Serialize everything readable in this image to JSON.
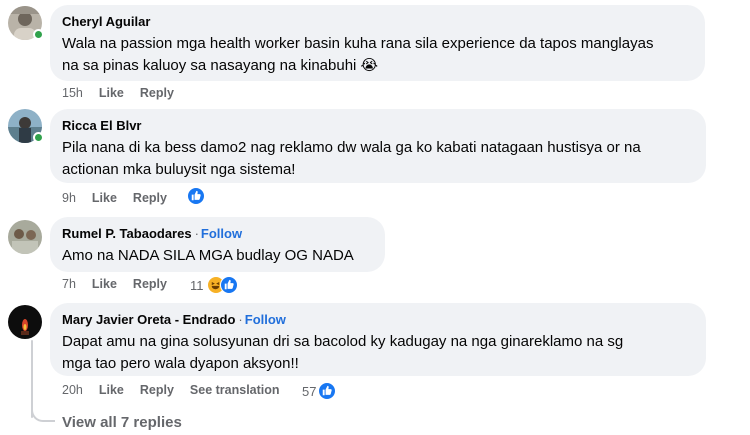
{
  "comments": [
    {
      "author": "Cheryl Aguilar",
      "follow": "",
      "text_line1": "Wala na passion mga health worker basin kuha rana sila experience da tapos manglayas",
      "text_line2": "na sa pinas kaluoy sa nasayang na kinabuhi",
      "emoji": "😭",
      "time": "15h",
      "like": "Like",
      "reply": "Reply",
      "online": true
    },
    {
      "author": "Ricca El Blvr",
      "follow": "",
      "text_line1": "Pila nana di ka bess damo2 nag reklamo dw wala ga ko kabati natagaan hustisya or na",
      "text_line2": "actionan mka buluysit nga sistema!",
      "time": "9h",
      "like": "Like",
      "reply": "Reply",
      "reaction_count": ""
    },
    {
      "author": "Rumel P. Tabaodares",
      "follow": "Follow",
      "text_line1": "Amo na NADA SILA MGA budlay OG NADA",
      "time": "7h",
      "like": "Like",
      "reply": "Reply",
      "reaction_count": "11"
    },
    {
      "author": "Mary Javier Oreta - Endrado",
      "follow": "Follow",
      "text_line1": "Dapat amu na gina solusyunan dri sa bacolod ky kadugay na nga ginareklamo na sg",
      "text_line2": "mga tao pero wala dyapon aksyon!!",
      "time": "20h",
      "like": "Like",
      "reply": "Reply",
      "see_translation": "See translation",
      "reaction_count": "57"
    }
  ],
  "view_replies": "View all 7 replies",
  "colors": {
    "bubble": "#f0f2f5",
    "secondary_text": "#65676b",
    "follow_link": "#216fdb",
    "like_reaction": "#1877f2",
    "haha_reaction": "#f7b125",
    "online": "#31a24c"
  },
  "icons": [
    "like-reaction-icon",
    "haha-reaction-icon"
  ]
}
